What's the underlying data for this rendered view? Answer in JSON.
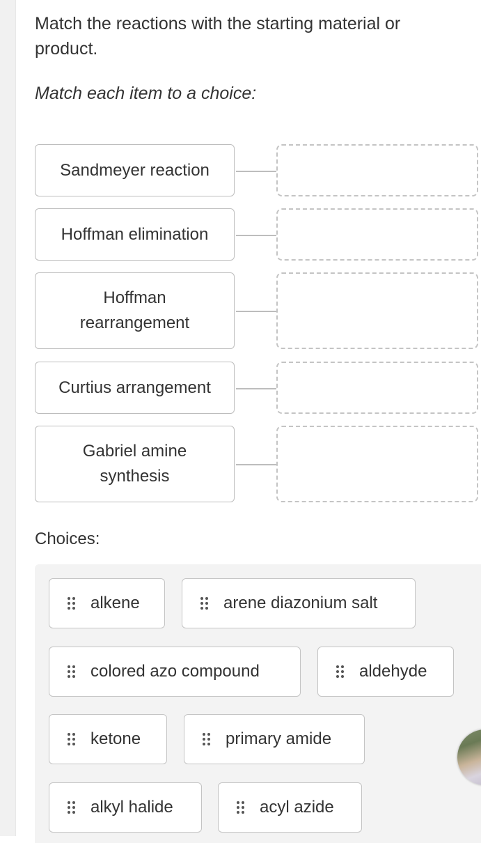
{
  "question": {
    "text": "Match the reactions with the starting material or product.",
    "instruction": "Match each item to a choice:"
  },
  "prompts": [
    {
      "label": "Sandmeyer reaction"
    },
    {
      "label": "Hoffman elimination"
    },
    {
      "label": "Hoffman rearrangement"
    },
    {
      "label": "Curtius arrangement"
    },
    {
      "label": "Gabriel amine synthesis"
    }
  ],
  "choices_label": "Choices:",
  "choices": [
    {
      "label": "alkene",
      "icon": "drag-handle-icon"
    },
    {
      "label": "arene diazonium salt",
      "icon": "drag-handle-icon"
    },
    {
      "label": "colored azo compound",
      "icon": "drag-handle-icon"
    },
    {
      "label": "aldehyde",
      "icon": "drag-handle-icon"
    },
    {
      "label": "ketone",
      "icon": "drag-handle-icon"
    },
    {
      "label": "primary amide",
      "icon": "drag-handle-icon"
    },
    {
      "label": "alkyl halide",
      "icon": "drag-handle-icon"
    },
    {
      "label": "acyl azide",
      "icon": "drag-handle-icon"
    }
  ]
}
